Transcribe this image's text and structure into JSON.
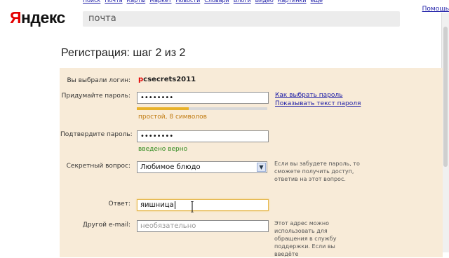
{
  "header": {
    "logo_first": "Я",
    "logo_rest": "ндекс",
    "search_value": "почта",
    "help_link": "Помощь",
    "nav_links": [
      "Поиск",
      "Почта",
      "Карты",
      "Маркет",
      "Новости",
      "Словари",
      "Блоги",
      "Видео",
      "Картинки",
      "ещё"
    ]
  },
  "page": {
    "title": "Регистрация: шаг 2 из 2"
  },
  "form": {
    "login_label": "Вы выбрали логин:",
    "login_value_first": "p",
    "login_value_rest": "csecrets2011",
    "password_label": "Придумайте пароль:",
    "password_value": "••••••••",
    "password_strength": 0.4,
    "password_strength_text": "простой, 8 символов",
    "link_choose_password": "Как выбрать пароль",
    "link_show_password": "Показывать текст пароля",
    "confirm_label": "Подтвердите пароль:",
    "confirm_value": "••••••••",
    "confirm_status": "введено верно",
    "secret_question_label": "Секретный вопрос:",
    "secret_question_value": "Любимое блюдо",
    "secret_note": "Если вы забудете пароль, то сможете получить доступ, ответив на этот вопрос.",
    "answer_label": "Ответ:",
    "answer_value": "яишница",
    "other_email_label": "Другой e-mail:",
    "other_email_placeholder": "необязательно",
    "email_note": "Этот адрес можно использовать для обращения в службу поддержки. Если вы введёте"
  },
  "colors": {
    "panel_bg": "#f8ebd8",
    "logo_red": "#e30000",
    "link_blue": "#1a1aa6",
    "strength_orange": "#e8b22a",
    "ok_green": "#2f8a1e"
  }
}
